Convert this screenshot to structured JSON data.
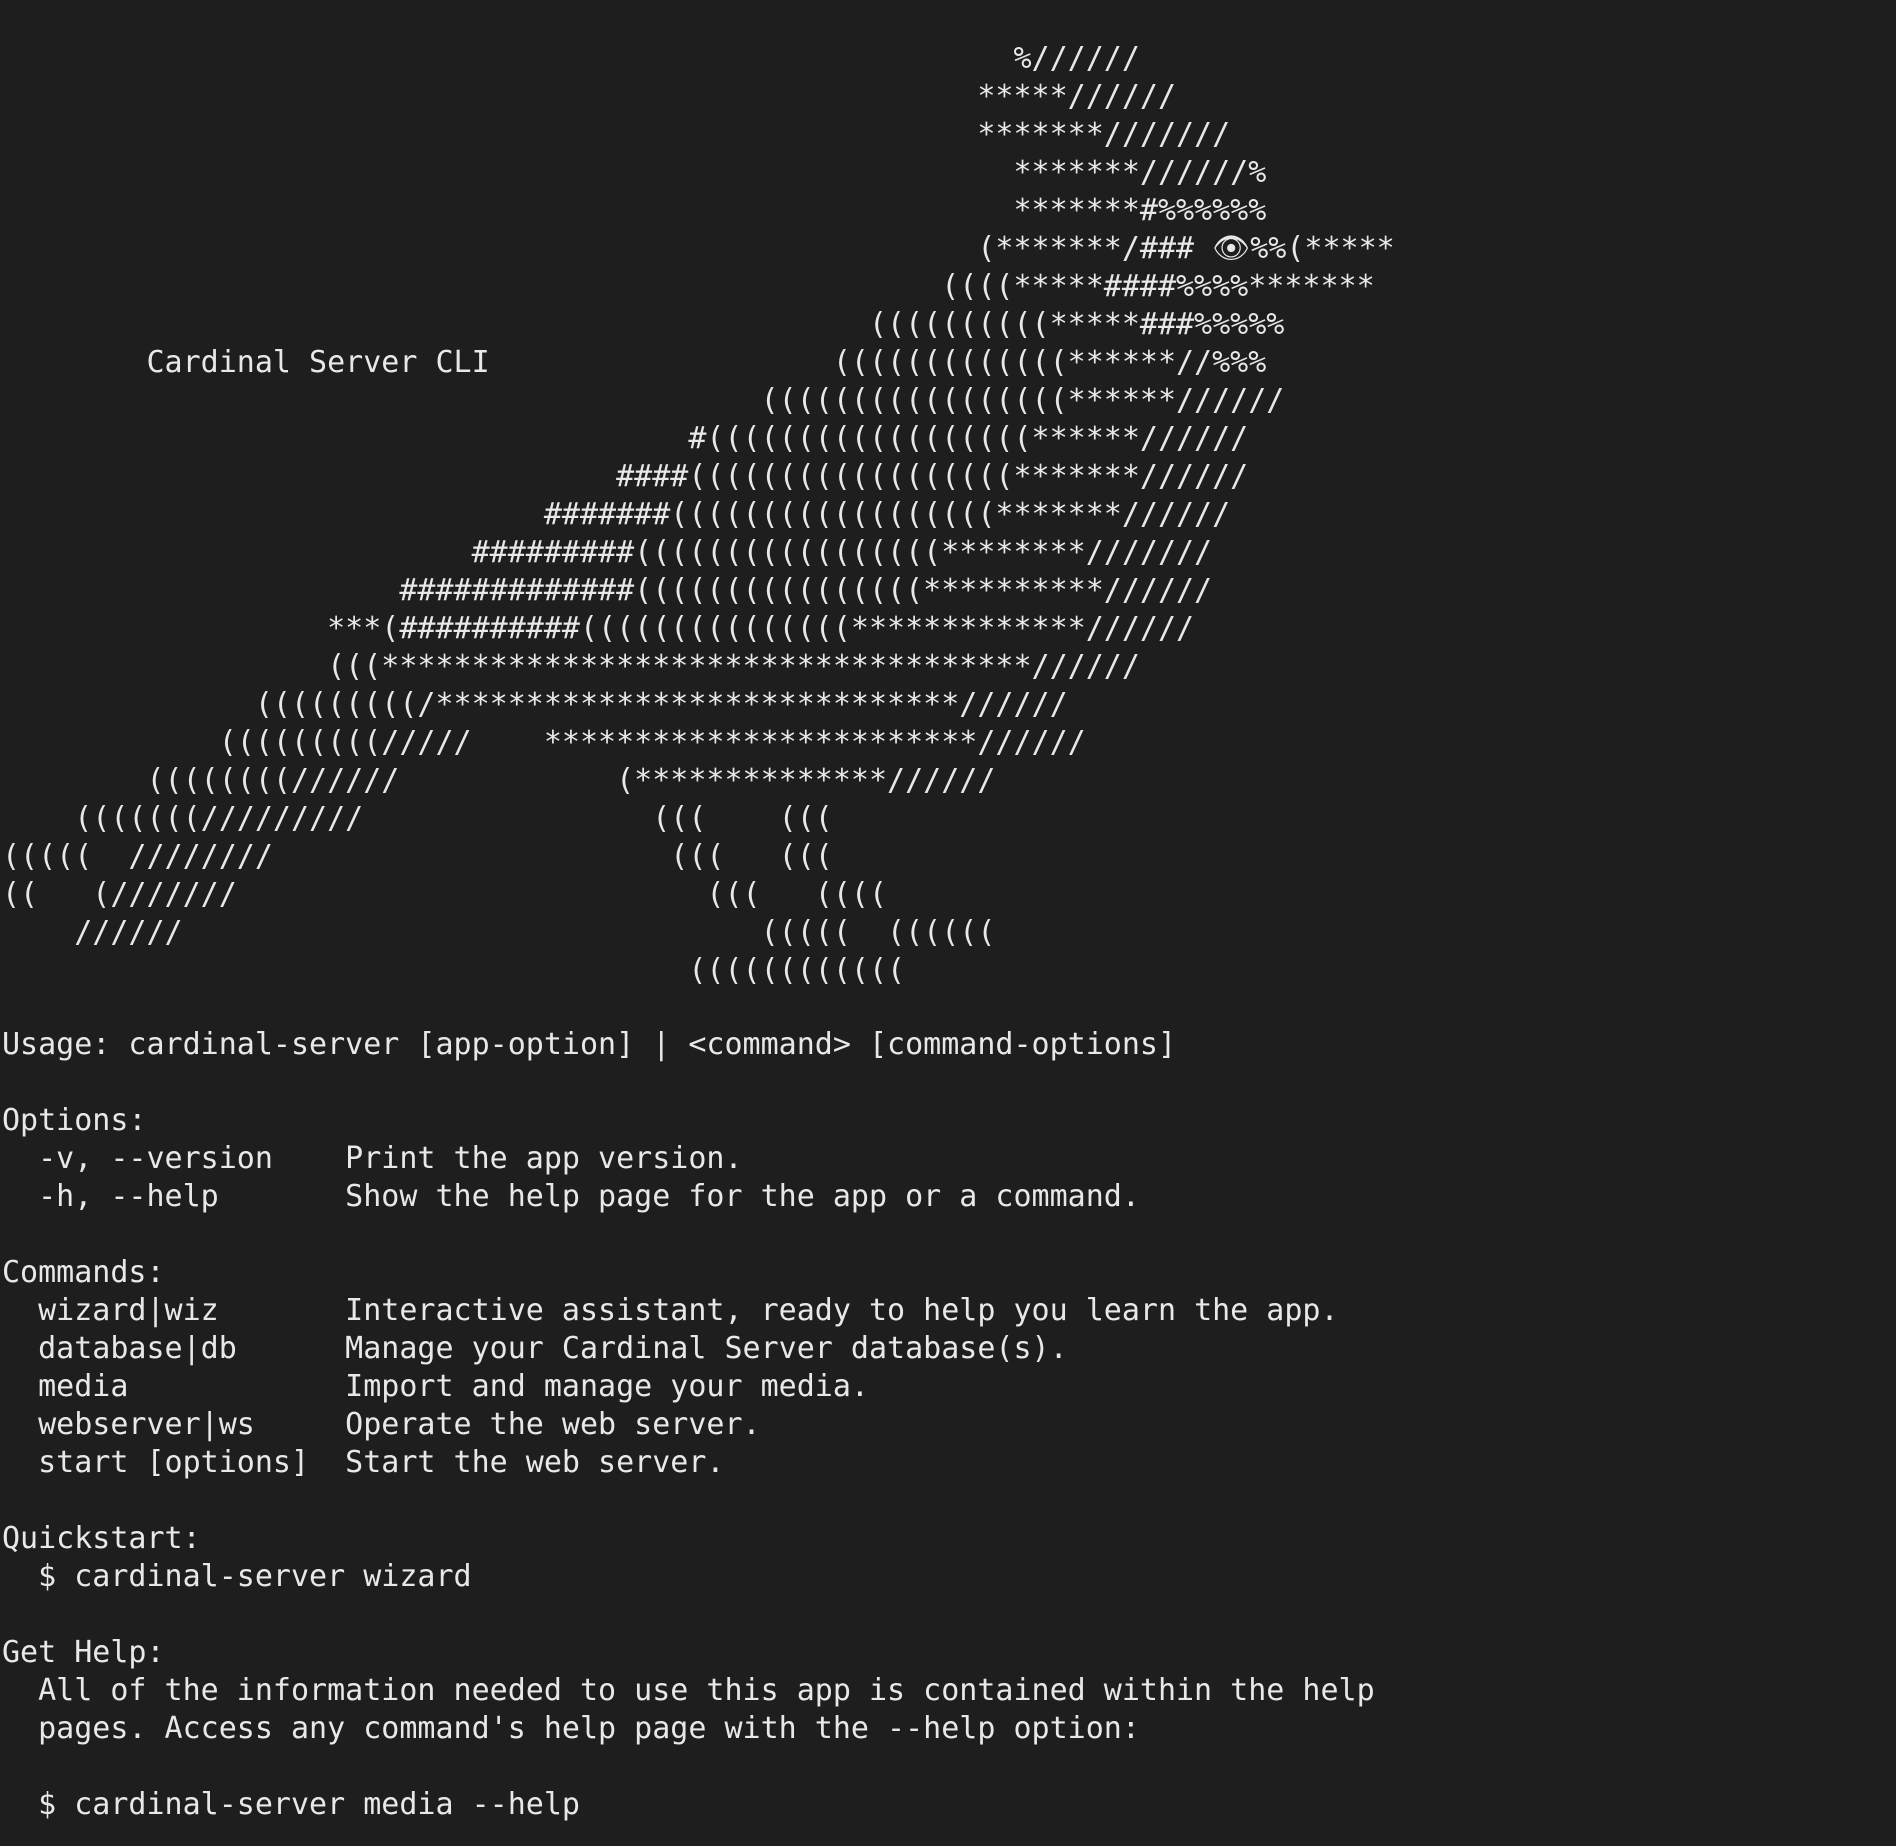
{
  "art": [
    "                                                        %//////",
    "                                                      *****//////",
    "                                                      *******///////",
    "                                                        *******//////%",
    "                                                        *******#%%%%%%",
    "                                                      (*******/### 👁︎%%(*****",
    "                                                    ((((*****####%%%%*******",
    "                                                ((((((((((*****###%%%%%",
    "        Cardinal Server CLI                   (((((((((((((******//%%%",
    "                                          (((((((((((((((((******//////",
    "                                      #((((((((((((((((((******//////",
    "                                  ####((((((((((((((((((*******//////",
    "                              #######((((((((((((((((((*******//////",
    "                          #########(((((((((((((((((********///////",
    "                      #############((((((((((((((((**********//////",
    "                  ***(##########(((((((((((((((*************//////",
    "                  (((************************************//////",
    "              (((((((((/*****************************//////",
    "            (((((((((/////    ************************//////",
    "        ((((((((//////            (**************//////",
    "    (((((((/////////                (((    (((",
    "(((((  ////////                      (((   (((",
    "((   (///////                          (((   ((((",
    "    //////                                (((((  ((((((",
    "                                      (((((((((((("
  ],
  "usage": "Usage: cardinal-server [app-option] | <command> [command-options]",
  "options_header": "Options:",
  "options": [
    {
      "flag": "  -v, --version    ",
      "desc": "Print the app version."
    },
    {
      "flag": "  -h, --help       ",
      "desc": "Show the help page for the app or a command."
    }
  ],
  "commands_header": "Commands:",
  "commands": [
    {
      "name": "  wizard|wiz       ",
      "desc": "Interactive assistant, ready to help you learn the app."
    },
    {
      "name": "  database|db      ",
      "desc": "Manage your Cardinal Server database(s)."
    },
    {
      "name": "  media            ",
      "desc": "Import and manage your media."
    },
    {
      "name": "  webserver|ws     ",
      "desc": "Operate the web server."
    },
    {
      "name": "  start [options]  ",
      "desc": "Start the web server."
    }
  ],
  "quickstart_header": "Quickstart:",
  "quickstart_cmd": "  $ cardinal-server wizard",
  "help_header": "Get Help:",
  "help_text_1": "  All of the information needed to use this app is contained within the help",
  "help_text_2": "  pages. Access any command's help page with the --help option:",
  "help_cmd": "  $ cardinal-server media --help"
}
